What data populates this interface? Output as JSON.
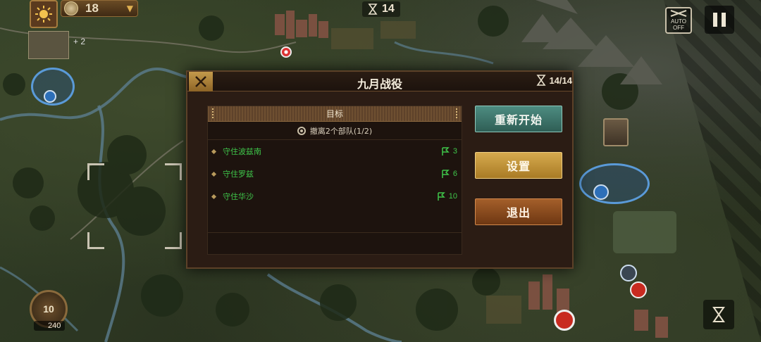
{
  "hud": {
    "medals": "18",
    "turn_counter": "14",
    "bonus": "+ 2",
    "auto_label": "AUTO",
    "auto_state": "OFF",
    "level": "10",
    "supply": "240"
  },
  "dialog": {
    "title": "九月战役",
    "turns": "14/14",
    "objectives_header": "目标",
    "evac_objective": "撤离2个部队(1/2)",
    "objectives": [
      {
        "label": "守住波兹南",
        "turns": "3"
      },
      {
        "label": "守住罗兹",
        "turns": "6"
      },
      {
        "label": "守住华沙",
        "turns": "10"
      }
    ],
    "buttons": {
      "restart": "重新开始",
      "settings": "设置",
      "exit": "退出"
    }
  },
  "colors": {
    "objective_green": "#3fc64a",
    "restart_teal": "#3b7468",
    "settings_gold": "#c39337",
    "exit_brown": "#8a4a1d"
  },
  "icons": [
    "sun-emblem-icon",
    "coin-icon",
    "chevron-down-icon",
    "hourglass-icon",
    "crossed-rifles-icon",
    "pause-icon",
    "close-icon",
    "target-icon",
    "flag-icon"
  ]
}
